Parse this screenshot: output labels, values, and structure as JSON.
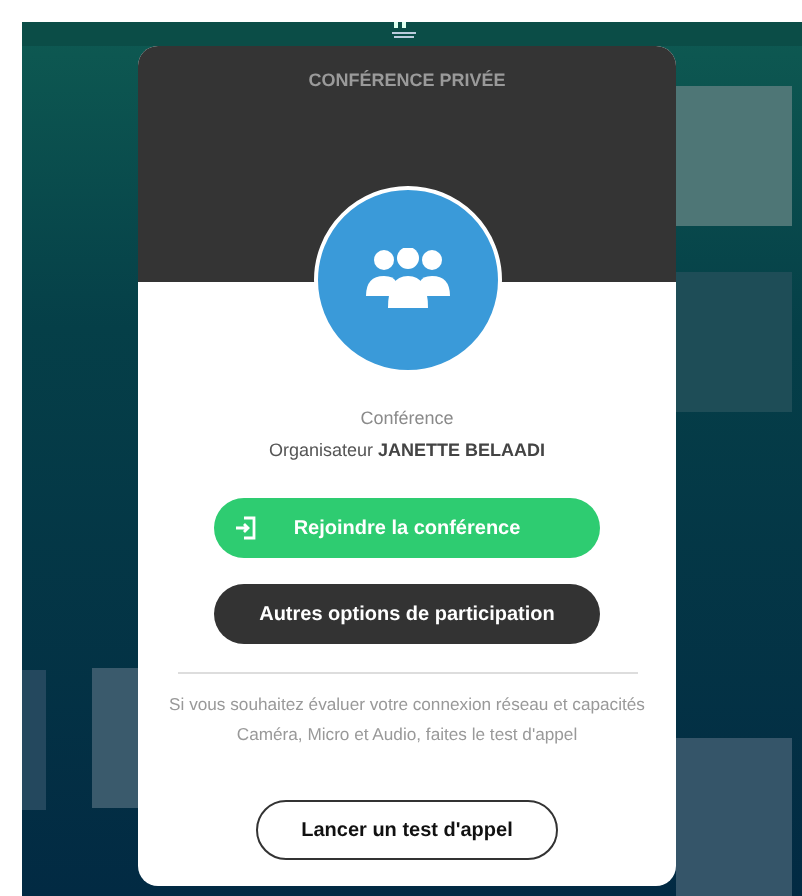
{
  "dialog": {
    "title": "CONFÉRENCE PRIVÉE",
    "subtitle": "Conférence",
    "organizer_label": "Organisateur",
    "organizer_name": "JANETTE BELAADI",
    "buttons": [
      {
        "kind": "primary",
        "label": "Rejoindre la conférence"
      },
      {
        "kind": "dark",
        "label": "Autres options de participation"
      }
    ],
    "note": "Si vous souhaitez évaluer votre connexion réseau et capacités Caméra, Micro et Audio, faites le test d'appel",
    "test_button": {
      "kind": "outline",
      "label": "Lancer un test d'appel"
    }
  }
}
